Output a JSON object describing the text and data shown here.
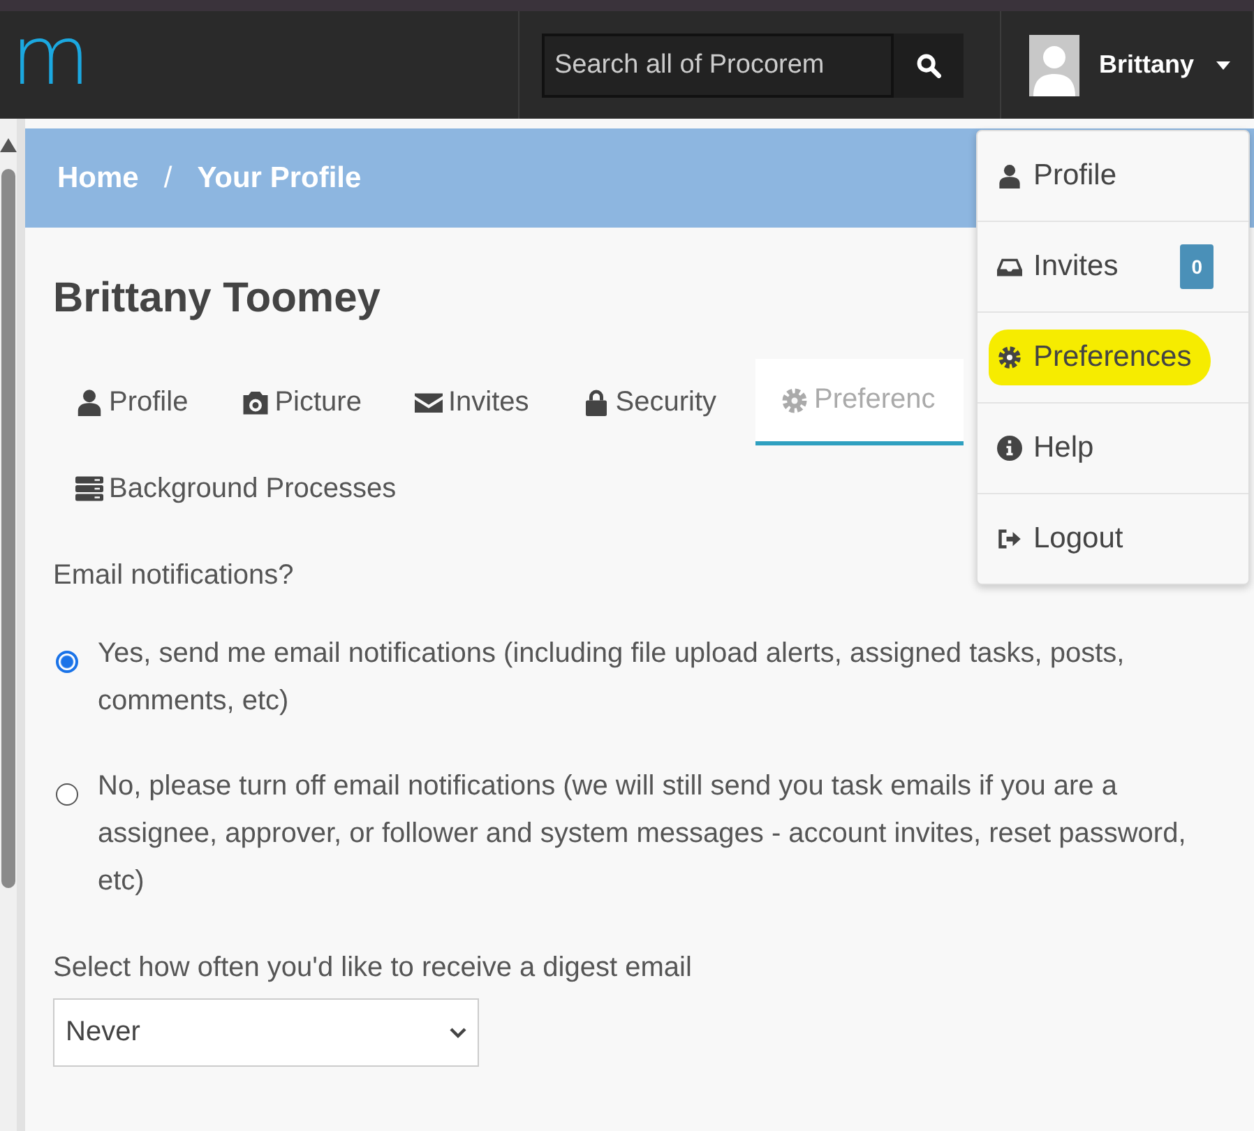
{
  "header": {
    "logo": "m",
    "search": {
      "placeholder": "Search all of Procorem"
    },
    "user": {
      "name": "Brittany"
    }
  },
  "breadcrumb": {
    "items": [
      "Home",
      "Your Profile"
    ],
    "separator": "/"
  },
  "profile": {
    "name": "Brittany Toomey"
  },
  "tabs": [
    {
      "label": "Profile",
      "kind": "user",
      "selected": false
    },
    {
      "label": "Picture",
      "kind": "camera",
      "selected": false
    },
    {
      "label": "Invites",
      "kind": "envelope",
      "selected": false
    },
    {
      "label": "Security",
      "kind": "lock",
      "selected": false
    },
    {
      "label": "Preferenc",
      "kind": "gear",
      "selected": true
    },
    {
      "label": "Background Processes",
      "kind": "server",
      "selected": false
    }
  ],
  "form": {
    "question": "Email notifications?",
    "options": [
      {
        "label": "Yes, send me email notifications (including file upload alerts, assigned tasks, posts, comments, etc)",
        "selected": true
      },
      {
        "label": "No, please turn off email notifications (we will still send you task emails if you are a assignee, approver, or follower and system messages - account invites, reset password, etc)",
        "selected": false
      }
    ],
    "digest": {
      "label": "Select how often you'd like to receive a digest email",
      "value": "Never"
    }
  },
  "user_menu": {
    "items": [
      {
        "label": "Profile",
        "kind": "user",
        "highlighted": false
      },
      {
        "label": "Invites",
        "kind": "inbox",
        "badge": "0",
        "highlighted": false
      },
      {
        "label": "Preferences",
        "kind": "gear",
        "highlighted": true
      },
      {
        "label": "Help",
        "kind": "info",
        "highlighted": false
      },
      {
        "label": "Logout",
        "kind": "signout",
        "highlighted": false
      }
    ]
  }
}
